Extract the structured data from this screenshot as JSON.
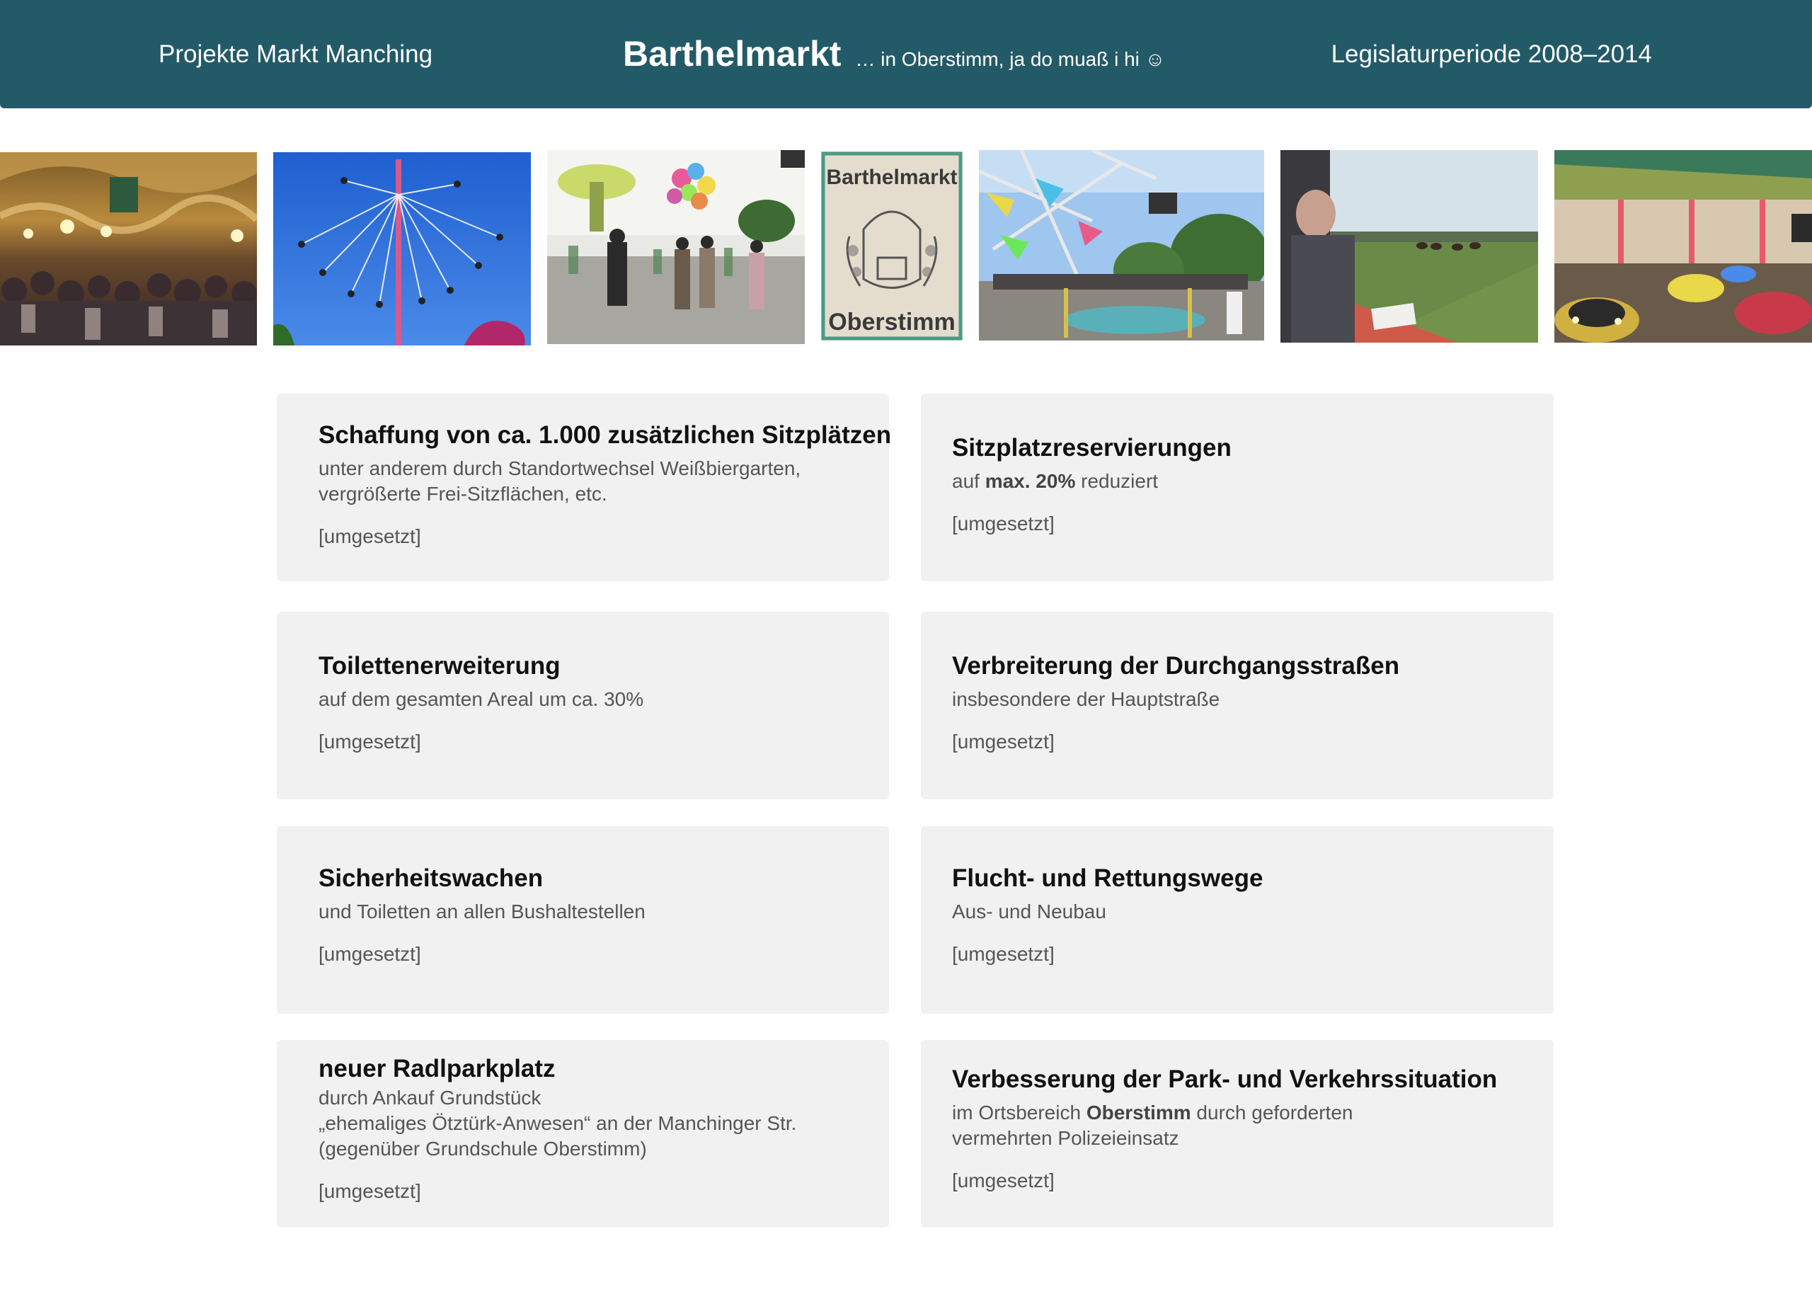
{
  "header": {
    "left_text": "Projekte Markt Manching",
    "title": "Barthelmarkt",
    "tagline": "… in Oberstimm, ja do muaß i hi ☺",
    "right_text": "Legislaturperiode 2008–2014",
    "background_color": "#235a67"
  },
  "photos": [
    {
      "name": "festival-tent-photo"
    },
    {
      "name": "swing-carousel-photo"
    },
    {
      "name": "fairground-crowd-photo"
    },
    {
      "name": "barthelmarkt-sign-photo",
      "sign_top": "Barthelmarkt",
      "sign_bottom": "Oberstimm"
    },
    {
      "name": "fairground-ride-photo"
    },
    {
      "name": "horse-race-grandstand-photo"
    },
    {
      "name": "bumper-cars-photo"
    }
  ],
  "projects": [
    {
      "title": "Schaffung von ca. 1.000 zusätzlichen Sitzplätzen",
      "desc_line1": "unter anderem durch Standortwechsel Weißbiergarten,",
      "desc_line2": "vergrößerte Frei-Sitzflächen, etc.",
      "status": "[umgesetzt]"
    },
    {
      "title": "Sitzplatzreservierungen",
      "desc_pre": "auf ",
      "desc_bold": "max. 20%",
      "desc_post": " reduziert",
      "status": "[umgesetzt]"
    },
    {
      "title": "Toilettenerweiterung",
      "desc_line1": "auf dem gesamten Areal um ca. 30%",
      "status": "[umgesetzt]"
    },
    {
      "title": "Verbreiterung der Durchgangsstraßen",
      "desc_line1": "insbesondere der Hauptstraße",
      "status": "[umgesetzt]"
    },
    {
      "title": "Sicherheitswachen",
      "desc_line1": "und Toiletten an allen Bushaltestellen",
      "status": "[umgesetzt]"
    },
    {
      "title": "Flucht- und Rettungswege",
      "desc_line1": "Aus- und Neubau",
      "status": "[umgesetzt]"
    },
    {
      "title": "neuer Radlparkplatz",
      "desc_line1": "durch Ankauf Grundstück",
      "desc_line2": "„ehemaliges Ötztürk-Anwesen“ an der Manchinger Str.",
      "desc_line3": "(gegenüber Grundschule Oberstimm)",
      "status": "[umgesetzt]"
    },
    {
      "title": "Verbesserung der Park- und Verkehrssituation",
      "desc_pre": "im Ortsbereich ",
      "desc_bold": "Oberstimm",
      "desc_post": " durch geforderten",
      "desc_line2": "vermehrten Polizeieinsatz",
      "status": "[umgesetzt]"
    }
  ]
}
